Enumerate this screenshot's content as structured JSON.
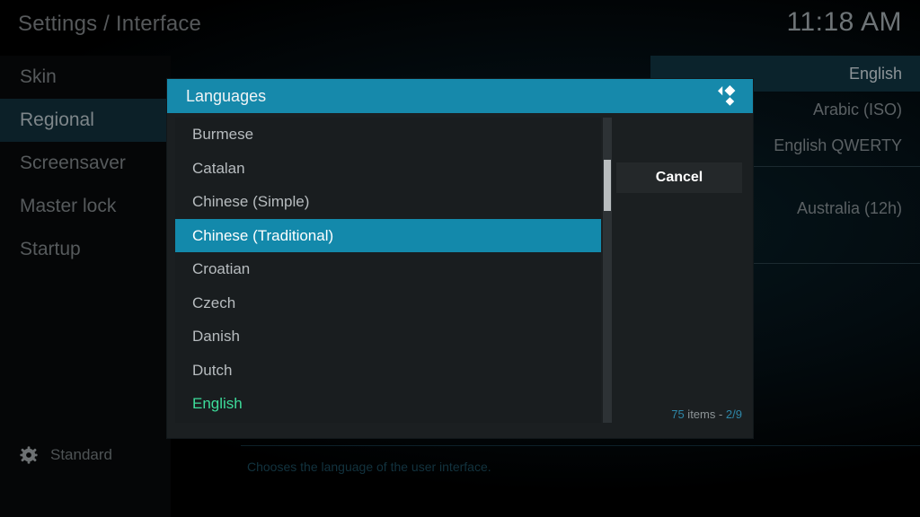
{
  "header": {
    "breadcrumb": "Settings / Interface",
    "clock": "11:18 AM"
  },
  "sidebar": {
    "items": [
      {
        "label": "Skin",
        "selected": false
      },
      {
        "label": "Regional",
        "selected": true
      },
      {
        "label": "Screensaver",
        "selected": false
      },
      {
        "label": "Master lock",
        "selected": false
      },
      {
        "label": "Startup",
        "selected": false
      }
    ],
    "level": {
      "icon": "gear-icon",
      "label": "Standard"
    }
  },
  "background_panel": {
    "rows": [
      {
        "label": "English",
        "selected": true
      },
      {
        "label": "Arabic (ISO)",
        "selected": false
      },
      {
        "label": "English QWERTY",
        "selected": false
      },
      {
        "label": "Australia (12h)",
        "selected": false
      }
    ],
    "help_text": "Chooses the language of the user interface."
  },
  "dialog": {
    "title": "Languages",
    "logo_icon": "kodi-logo-icon",
    "cancel_label": "Cancel",
    "counter": {
      "total": "75",
      "middle": " items - ",
      "position": "2/9",
      "full": "75 items - 2/9"
    },
    "list": [
      {
        "label": "Burmese",
        "state": "normal"
      },
      {
        "label": "Catalan",
        "state": "normal"
      },
      {
        "label": "Chinese (Simple)",
        "state": "normal"
      },
      {
        "label": "Chinese (Traditional)",
        "state": "selected"
      },
      {
        "label": "Croatian",
        "state": "normal"
      },
      {
        "label": "Czech",
        "state": "normal"
      },
      {
        "label": "Danish",
        "state": "normal"
      },
      {
        "label": "Dutch",
        "state": "normal"
      },
      {
        "label": "English",
        "state": "current"
      }
    ]
  },
  "colors": {
    "accent": "#1389ab",
    "header_accent": "#1689ab",
    "current_value": "#3ddc9a",
    "sidebar_selected": "#0c2028"
  }
}
